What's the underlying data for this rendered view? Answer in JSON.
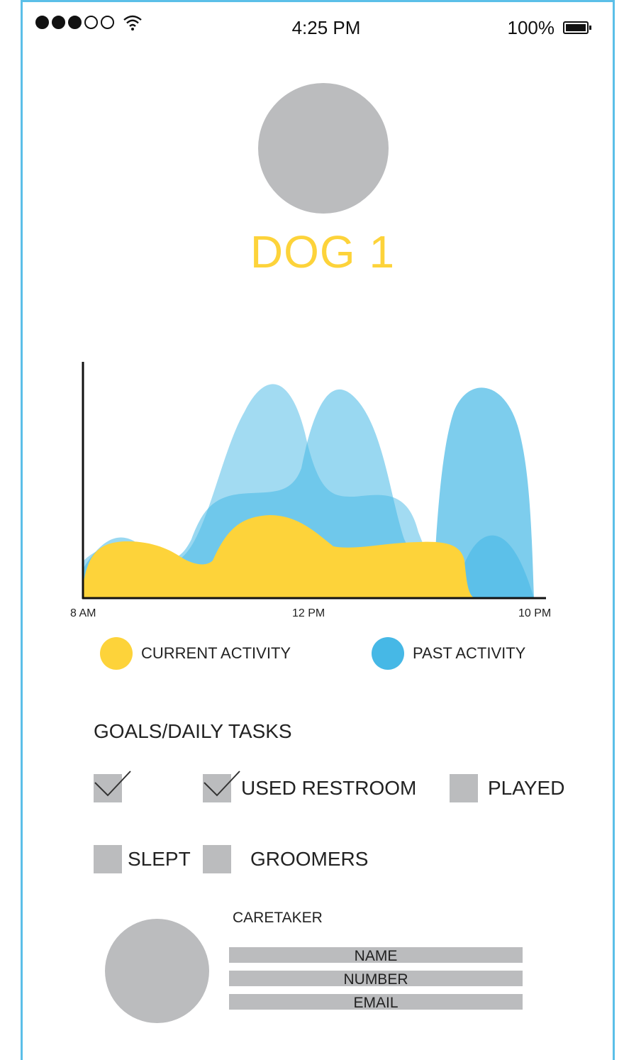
{
  "status_bar": {
    "time": "4:25 PM",
    "battery": "100%",
    "signal_strength": 3,
    "signal_max": 5
  },
  "dog": {
    "name": "DOG 1"
  },
  "chart_data": {
    "type": "area",
    "x_tick_labels": [
      "8 AM",
      "12 PM",
      "10 PM"
    ],
    "series": [
      {
        "name": "CURRENT ACTIVITY",
        "color": "#fdd33a"
      },
      {
        "name": "PAST ACTIVITY",
        "color": "#46b8e6"
      }
    ]
  },
  "legend": {
    "current": "CURRENT ACTIVITY",
    "past": "PAST ACTIVITY"
  },
  "goals": {
    "title": "GOALS/DAILY TASKS",
    "tasks": [
      {
        "label": "",
        "checked": true
      },
      {
        "label": "USED RESTROOM",
        "checked": true
      },
      {
        "label": "PLAYED",
        "checked": false
      },
      {
        "label": "SLEPT",
        "checked": false
      },
      {
        "label": "GROOMERS",
        "checked": false
      }
    ]
  },
  "caretaker": {
    "title": "CARETAKER",
    "name": "NAME",
    "number": "NUMBER",
    "email": "EMAIL"
  },
  "colors": {
    "accent_yellow": "#fdd33a",
    "accent_blue": "#46b8e6",
    "placeholder_gray": "#bbbcbe",
    "frame_border": "#5bbfe8"
  }
}
